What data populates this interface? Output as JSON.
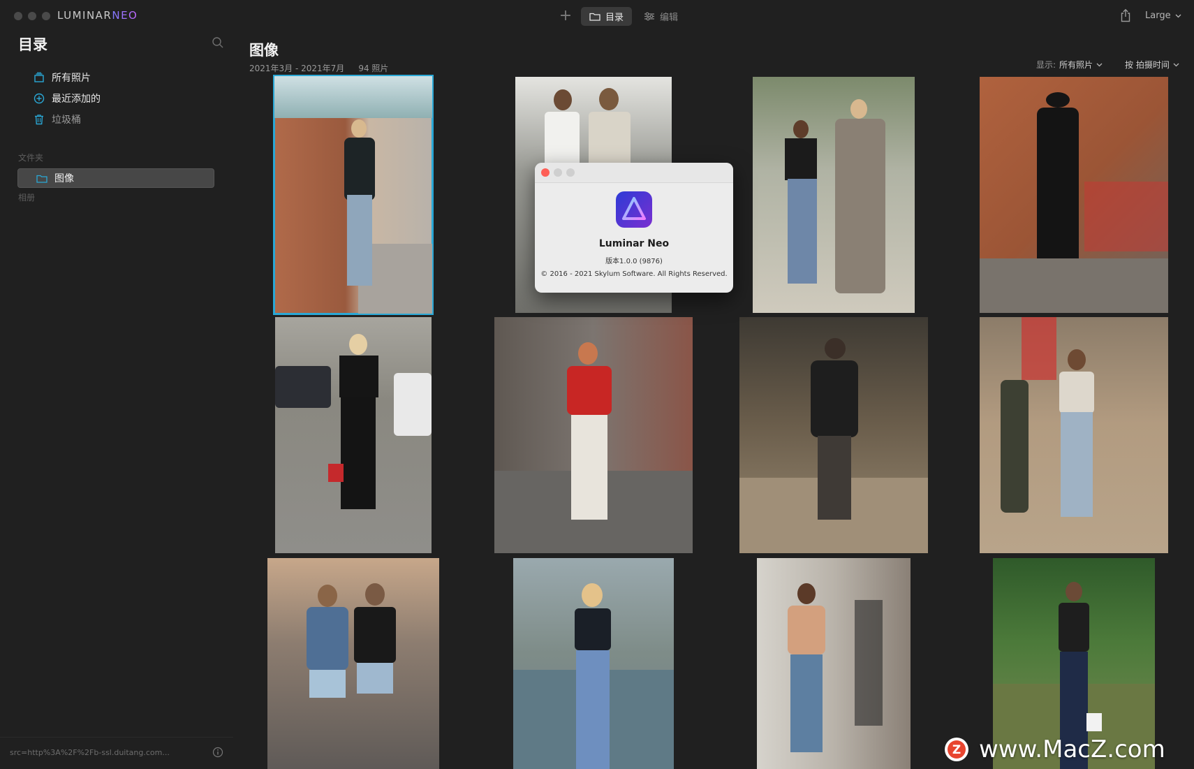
{
  "app": {
    "logo_main": "LUMINAR",
    "logo_accent": "NEO"
  },
  "toolbar": {
    "add_label": "+",
    "tabs": [
      {
        "label": "目录",
        "icon": "folder-icon",
        "active": true
      },
      {
        "label": "编辑",
        "icon": "sliders-icon",
        "active": false
      }
    ],
    "size_label": "Large"
  },
  "sidebar": {
    "title": "目录",
    "items": [
      {
        "label": "所有照片",
        "icon": "photo-stack-icon"
      },
      {
        "label": "最近添加的",
        "icon": "plus-circle-icon"
      },
      {
        "label": "垃圾桶",
        "icon": "trash-icon"
      }
    ],
    "folders_section": "文件夹",
    "folder": {
      "label": "图像",
      "icon": "folder-icon"
    },
    "albums_section": "相册",
    "footer_text": "src=http%3A%2F%2Fb-ssl.duitang.com..."
  },
  "main": {
    "title": "图像",
    "date_range": "2021年3月 - 2021年7月",
    "count": "94 照片",
    "filter_label": "显示:",
    "filter_value": "所有照片",
    "sort_label": "按 拍摄时间"
  },
  "about": {
    "app_name": "Luminar Neo",
    "version": "版本1.0.0 (9876)",
    "copyright": "© 2016 - 2021 Skylum Software. All Rights Reserved."
  },
  "watermark": {
    "text": "www.MacZ.com",
    "badge": "Z"
  },
  "colors": {
    "background": "#202020",
    "accent": "#2aa8d6",
    "sidebar_icon": "#2aa8d6",
    "selection": "#474747"
  }
}
